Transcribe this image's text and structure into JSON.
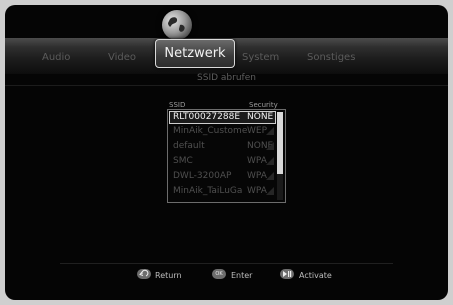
{
  "tabs": [
    {
      "label": "Audio"
    },
    {
      "label": "Video"
    },
    {
      "label": "Netzwerk"
    },
    {
      "label": "System"
    },
    {
      "label": "Sonstiges"
    }
  ],
  "active_tab": "Netzwerk",
  "page_subtitle": "SSID abrufen",
  "list": {
    "columns": [
      "SSID",
      "Security"
    ],
    "rows": [
      {
        "ssid": "RLT00027288E",
        "security": "NONE"
      },
      {
        "ssid": "MinAik_Custome",
        "security": "WEP"
      },
      {
        "ssid": "default",
        "security": "NONE"
      },
      {
        "ssid": "SMC",
        "security": "WPA"
      },
      {
        "ssid": "DWL-3200AP",
        "security": "WPA"
      },
      {
        "ssid": "MinAik_TaiLuGa",
        "security": "WPA"
      }
    ],
    "selected_index": 0
  },
  "footer": [
    {
      "icon": "return-icon",
      "label": "Return"
    },
    {
      "icon": "ok-icon",
      "icon_text": "OK",
      "label": "Enter"
    },
    {
      "icon": "play-pause-icon",
      "label": "Activate"
    }
  ],
  "colors": {
    "selected_text": "#f2f2f2",
    "inactive_text": "#4f4f4f",
    "background": "#050505"
  }
}
